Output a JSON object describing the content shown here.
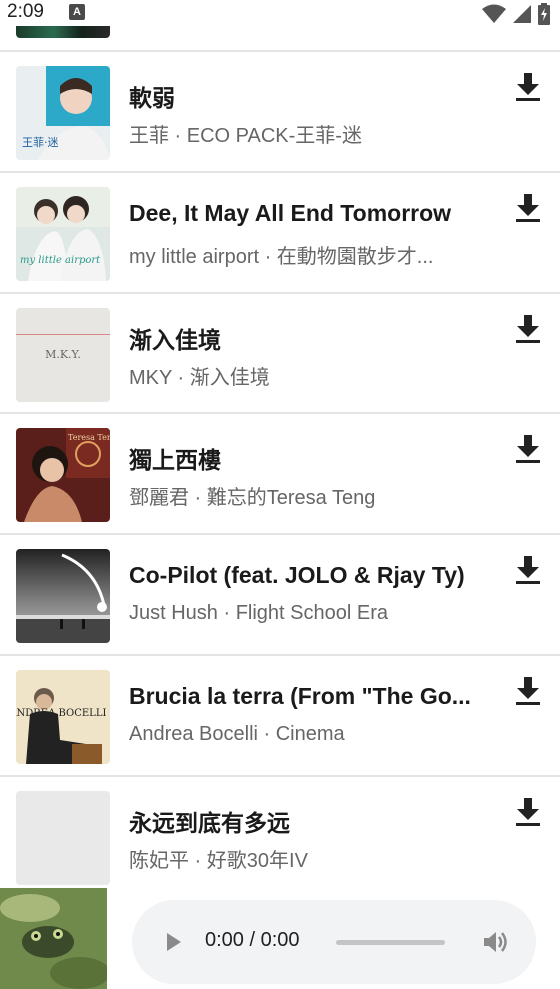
{
  "status_bar": {
    "time": "2:09",
    "notification_icon_letter": "A"
  },
  "tracks": [
    {
      "title": "軟弱",
      "subtitle": "王菲 · ECO PACK-王菲-迷",
      "art_text": "王菲·迷"
    },
    {
      "title": "Dee, It May All End Tomorrow",
      "subtitle": "my little airport · 在動物園散步才...",
      "art_text": "my little airport"
    },
    {
      "title": "渐入佳境",
      "subtitle": "MKY · 渐入佳境",
      "art_text": "M.K.Y."
    },
    {
      "title": "獨上西樓",
      "subtitle": "鄧麗君 · 難忘的Teresa Teng",
      "art_text": "Teresa Teng"
    },
    {
      "title": "Co-Pilot (feat. JOLO & Rjay Ty)",
      "subtitle": "Just Hush · Flight School Era",
      "art_text": ""
    },
    {
      "title": "Brucia la terra (From \"The Go...",
      "subtitle": "Andrea Bocelli · Cinema",
      "art_text": "ANDREA BOCELLI CINEMA"
    },
    {
      "title": "永远到底有多远",
      "subtitle": "陈妃平 · 好歌30年IV",
      "art_text": ""
    }
  ],
  "player": {
    "time_display": "0:00 / 0:00",
    "progress_fraction": 0
  },
  "colors": {
    "divider": "#e4e4e4",
    "subtitle": "#666666",
    "player_bg": "#f1f3f4"
  }
}
